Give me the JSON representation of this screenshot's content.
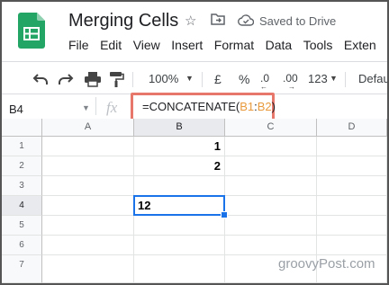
{
  "document": {
    "title": "Merging Cells",
    "status": "Saved to Drive"
  },
  "colors": {
    "sheets_green": "#23a566",
    "highlight": "#e8776b",
    "selection": "#1a73e8",
    "reference": "#e89a3c"
  },
  "icons": [
    "sheets-logo-icon",
    "star-icon",
    "move-folder-icon",
    "cloud-saved-icon",
    "undo-icon",
    "redo-icon",
    "print-icon",
    "paint-format-icon",
    "chevron-down-icon",
    "fx-icon"
  ],
  "menu": [
    "File",
    "Edit",
    "View",
    "Insert",
    "Format",
    "Data",
    "Tools",
    "Exten"
  ],
  "toolbar": {
    "zoom": "100%",
    "currency": "£",
    "percent": "%",
    "decrease_decimal": ".0",
    "increase_decimal": ".00",
    "more_formats": "123",
    "font": "Defaul"
  },
  "formula_bar": {
    "name_box": "B4",
    "fx": "fx",
    "formula_prefix": "=CONCATENATE(",
    "ref1": "B1",
    "colon": ":",
    "ref2": "B2",
    "formula_suffix": ")"
  },
  "sheet": {
    "columns": [
      "A",
      "B",
      "C",
      "D"
    ],
    "rows": [
      "1",
      "2",
      "3",
      "4",
      "5",
      "6",
      "7"
    ],
    "cells": {
      "B1": "1",
      "B2": "2",
      "B4": "12"
    },
    "active_cell": "B4"
  },
  "watermark": "groovyPost.com"
}
